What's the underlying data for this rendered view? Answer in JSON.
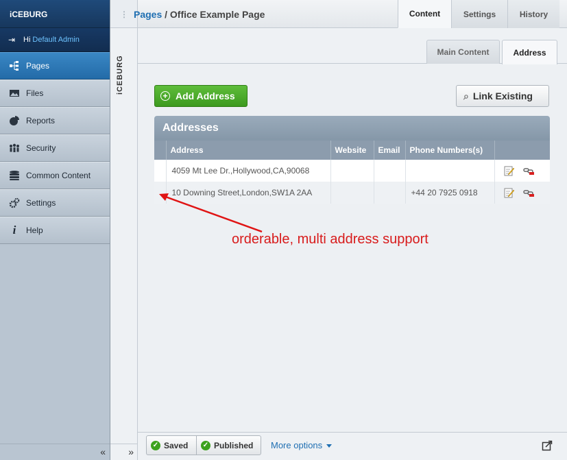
{
  "brand": "iCEBURG",
  "user": {
    "greeting": "Hi",
    "name": "Default Admin"
  },
  "sidebar": {
    "items": [
      {
        "label": "Pages",
        "icon": "sitemap-icon",
        "active": true
      },
      {
        "label": "Files",
        "icon": "image-icon"
      },
      {
        "label": "Reports",
        "icon": "pie-chart-icon"
      },
      {
        "label": "Security",
        "icon": "users-icon"
      },
      {
        "label": "Common Content",
        "icon": "database-icon"
      },
      {
        "label": "Settings",
        "icon": "gears-icon"
      },
      {
        "label": "Help",
        "icon": "info-icon"
      }
    ],
    "collapse_glyph": "«"
  },
  "vstrip": {
    "label": "iCEBURG",
    "expand_glyph": "»"
  },
  "breadcrumb": {
    "link": "Pages",
    "separator": " / ",
    "current": "Office Example Page"
  },
  "top_tabs": [
    {
      "label": "Content",
      "active": true
    },
    {
      "label": "Settings"
    },
    {
      "label": "History"
    }
  ],
  "sub_tabs": [
    {
      "label": "Main Content"
    },
    {
      "label": "Address",
      "active": true
    }
  ],
  "buttons": {
    "add": "Add Address",
    "link": "Link Existing"
  },
  "addresses": {
    "title": "Addresses",
    "columns": [
      "Address",
      "Website",
      "Email",
      "Phone Numbers(s)"
    ],
    "rows": [
      {
        "address": "4059 Mt Lee Dr.,Hollywood,CA,90068",
        "website": "",
        "email": "",
        "phone": ""
      },
      {
        "address": "10 Downing Street,London,SW1A 2AA",
        "website": "",
        "email": "",
        "phone": "+44 20 7925 0918"
      }
    ]
  },
  "annotation": "orderable, multi address support",
  "footer": {
    "saved": "Saved",
    "published": "Published",
    "more_options": "More options"
  },
  "colors": {
    "accent_blue": "#1f6fb2",
    "annotation_red": "#d81b1b",
    "add_green": "#4aab2a"
  }
}
